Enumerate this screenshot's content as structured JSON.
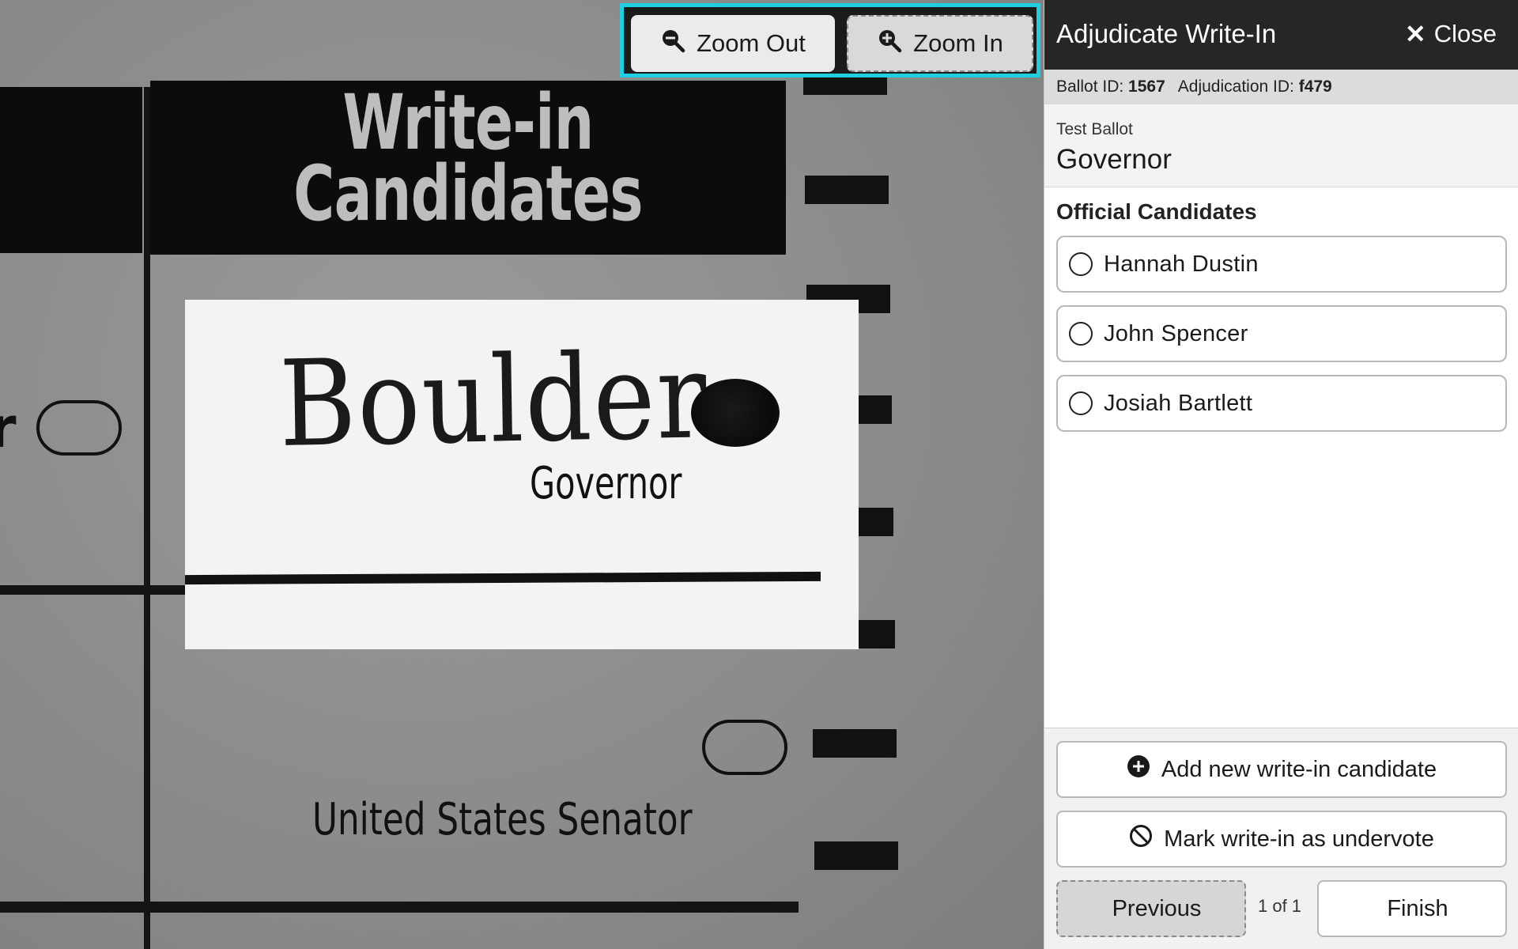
{
  "viewer": {
    "header_line1": "Write-in",
    "header_line2": "Candidates",
    "writein_handwriting": "Boulder",
    "writein_office": "Governor",
    "next_contest_label": "United States Senator",
    "zoom_out_label": "Zoom Out",
    "zoom_in_label": "Zoom In"
  },
  "panel": {
    "title": "Adjudicate Write-In",
    "close_label": "Close",
    "ballot_id_label": "Ballot ID:",
    "ballot_id": "1567",
    "adjudication_id_label": "Adjudication ID:",
    "adjudication_id": "f479",
    "ballot_style": "Test Ballot",
    "contest_title": "Governor",
    "candidates_heading": "Official Candidates",
    "candidates": [
      {
        "name": "Hannah Dustin"
      },
      {
        "name": "John Spencer"
      },
      {
        "name": "Josiah Bartlett"
      }
    ],
    "add_writein_label": "Add new write-in candidate",
    "undervote_label": "Mark write-in as undervote",
    "previous_label": "Previous",
    "pager": "1 of 1",
    "finish_label": "Finish"
  },
  "colors": {
    "focus_outline": "#1ecfe0",
    "header_bg": "#262626",
    "meta_bg": "#dcdcdc"
  },
  "icons": [
    "zoom-out-icon",
    "zoom-in-icon",
    "close-icon",
    "radio-icon",
    "plus-circle-icon",
    "ban-icon",
    "arrow-left-circle-icon",
    "check-circle-icon"
  ]
}
